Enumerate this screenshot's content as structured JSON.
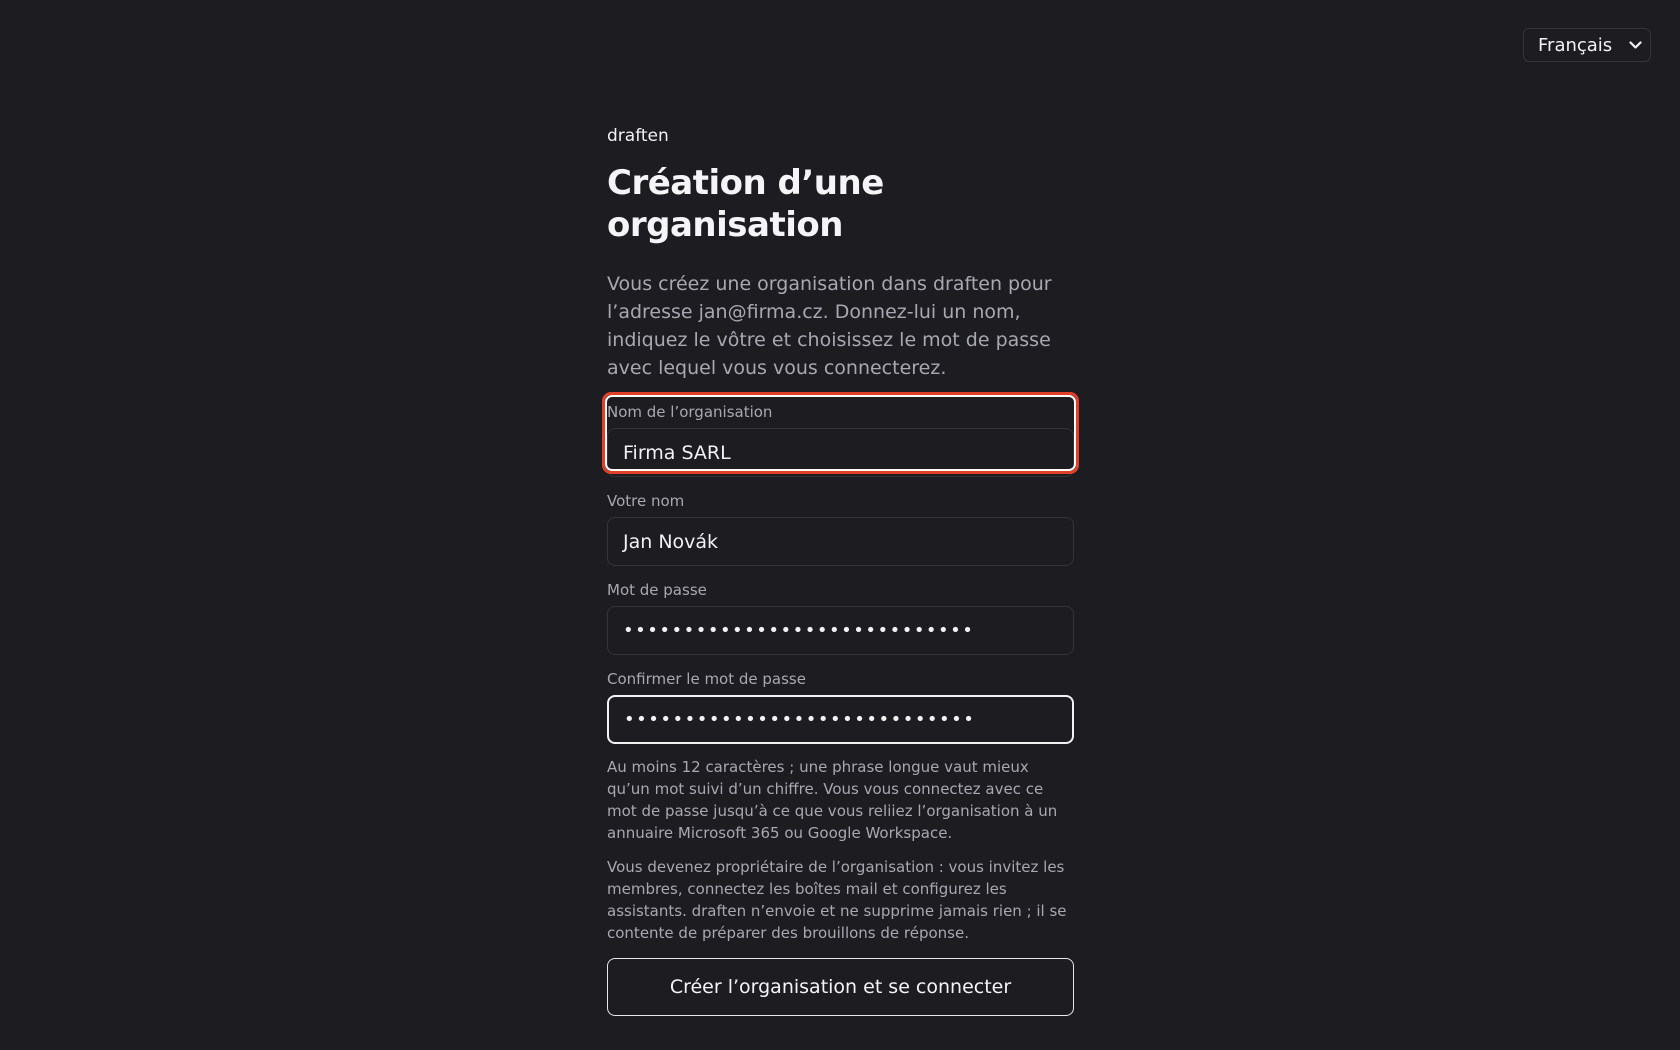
{
  "header": {
    "language_selector": {
      "selected": "Français",
      "icon": "chevron-down-icon"
    }
  },
  "brand": "draften",
  "title": "Création d’une organisation",
  "intro": "Vous créez une organisation dans draften pour l’adresse jan@firma.cz. Donnez-lui un nom, indiquez le vôtre et choisissez le mot de passe avec lequel vous vous connecterez.",
  "form": {
    "organization_name": {
      "label": "Nom de l’organisation",
      "value": "Firma SARL"
    },
    "your_name": {
      "label": "Votre nom",
      "value": "Jan Novák"
    },
    "password": {
      "label": "Mot de passe",
      "value": "•••••••••••••••••••••••••••••"
    },
    "confirm_password": {
      "label": "Confirmer le mot de passe",
      "value": "•••••••••••••••••••••••••••••"
    }
  },
  "password_hint": "Au moins 12 caractères ; une phrase longue vaut mieux qu’un mot suivi d’un chiffre. Vous vous connectez avec ce mot de passe jusqu’à ce que vous reliiez l’organisation à un annuaire Microsoft 365 ou Google Workspace.",
  "owner_note": "Vous devenez propriétaire de l’organisation : vous invitez les membres, connectez les boîtes mail et configurez les assistants. draften n’envoie et ne supprime jamais rien ; il se contente de préparer des brouillons de réponse.",
  "submit_label": "Créer l’organisation et se connecter",
  "colors": {
    "background": "#1c1c21",
    "highlight": "#e0402a",
    "muted_text": "#a8a8b0"
  }
}
